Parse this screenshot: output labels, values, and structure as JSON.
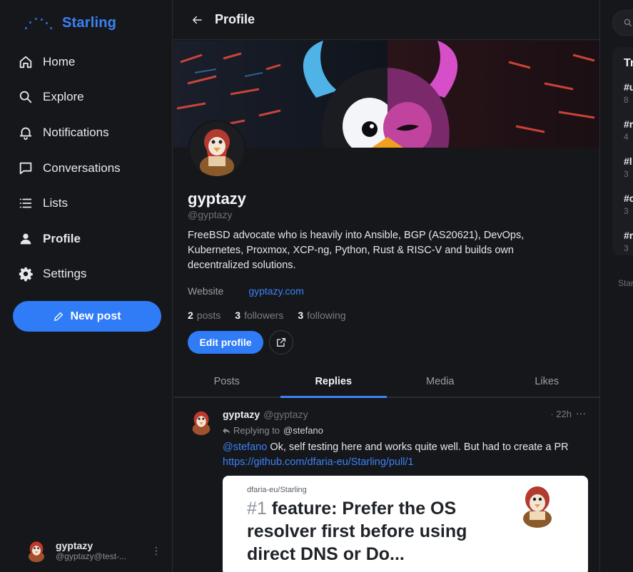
{
  "brand": {
    "name": "Starling"
  },
  "nav": {
    "items": [
      {
        "label": "Home",
        "icon": "home-icon"
      },
      {
        "label": "Explore",
        "icon": "search-icon"
      },
      {
        "label": "Notifications",
        "icon": "bell-icon"
      },
      {
        "label": "Conversations",
        "icon": "chat-icon"
      },
      {
        "label": "Lists",
        "icon": "list-icon"
      },
      {
        "label": "Profile",
        "icon": "person-icon",
        "active": true
      },
      {
        "label": "Settings",
        "icon": "gear-icon"
      }
    ],
    "new_post": "New post"
  },
  "account": {
    "name": "gyptazy",
    "handle": "@gyptazy@test-..."
  },
  "header": {
    "title": "Profile"
  },
  "profile": {
    "display_name": "gyptazy",
    "handle": "@gyptazy",
    "bio": "FreeBSD advocate who is heavily into Ansible, BGP (AS20621), DevOps, Kubernetes, Proxmox, XCP-ng, Python, Rust & RISC-V and builds own decentralized solutions.",
    "field_label": "Website",
    "field_value": "gyptazy.com",
    "stats": {
      "posts_count": "2",
      "posts_label": "posts",
      "followers_count": "3",
      "followers_label": "followers",
      "following_count": "3",
      "following_label": "following"
    },
    "edit_label": "Edit profile"
  },
  "tabs": [
    {
      "label": "Posts"
    },
    {
      "label": "Replies",
      "active": true
    },
    {
      "label": "Media"
    },
    {
      "label": "Likes"
    }
  ],
  "post": {
    "author": "gyptazy",
    "handle": "@gyptazy",
    "time": "· 22h",
    "menu": "···",
    "reply_prefix": "Replying to",
    "reply_to": "@stefano",
    "mention": "@stefano",
    "text": " Ok, self testing here and works quite well. But had to create a PR",
    "link": "https://github.com/dfaria-eu/Starling/pull/1",
    "card": {
      "repo": "dfaria-eu/Starling",
      "number": "#1",
      "title": " feature: Prefer the OS resolver first before using direct DNS or Do..."
    }
  },
  "right": {
    "trending_title": "Tr",
    "trends": [
      {
        "tag": "#u",
        "count": "8"
      },
      {
        "tag": "#r",
        "count": "4"
      },
      {
        "tag": "#l",
        "count": "3"
      },
      {
        "tag": "#c",
        "count": "3"
      },
      {
        "tag": "#r",
        "count": "3"
      }
    ],
    "footer": "Star"
  },
  "colors": {
    "accent": "#2f7cf6",
    "link": "#3b82f6",
    "background": "#16171b"
  }
}
